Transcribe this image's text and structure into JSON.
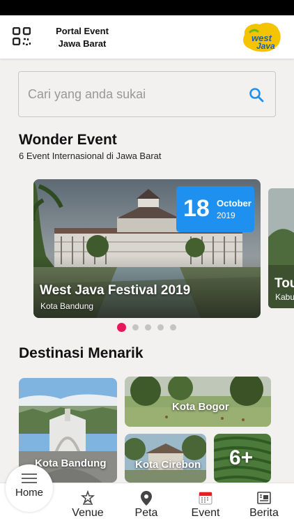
{
  "header": {
    "title_line1": "Portal Event",
    "title_line2": "Jawa Barat",
    "logo_text": "West Java"
  },
  "search": {
    "placeholder": "Cari yang anda sukai"
  },
  "wonder_event": {
    "title": "Wonder Event",
    "subtitle": "6 Event Internasional di Jawa Barat",
    "cards": [
      {
        "day": "18",
        "month": "October",
        "year": "2019",
        "title": "West Java Festival 2019",
        "location": "Kota Bandung"
      },
      {
        "title": "Tou",
        "location": "Kabu"
      }
    ],
    "pagination": {
      "count": 5,
      "active_index": 0
    }
  },
  "destinasi": {
    "title": "Destinasi Menarik",
    "items": [
      {
        "label": "Kota Bandung"
      },
      {
        "label": "Kota Bogor"
      },
      {
        "label": "Kota Cirebon"
      },
      {
        "label": "6+"
      }
    ]
  },
  "tabbar": {
    "home": "Home",
    "venue": "Venue",
    "peta": "Peta",
    "event": "Event",
    "berita": "Berita"
  },
  "colors": {
    "accent_blue": "#1e90f0",
    "active_dot": "#e8175d",
    "logo_yellow": "#f5c400",
    "event_icon_red": "#e0202a",
    "background": "#f3f0f0"
  },
  "icons": {
    "qr": "qr-code-icon",
    "search": "search-icon",
    "home": "hamburger-menu-icon",
    "venue": "stadium-icon",
    "peta": "map-pin-icon",
    "event": "calendar-icon",
    "berita": "newspaper-icon"
  }
}
